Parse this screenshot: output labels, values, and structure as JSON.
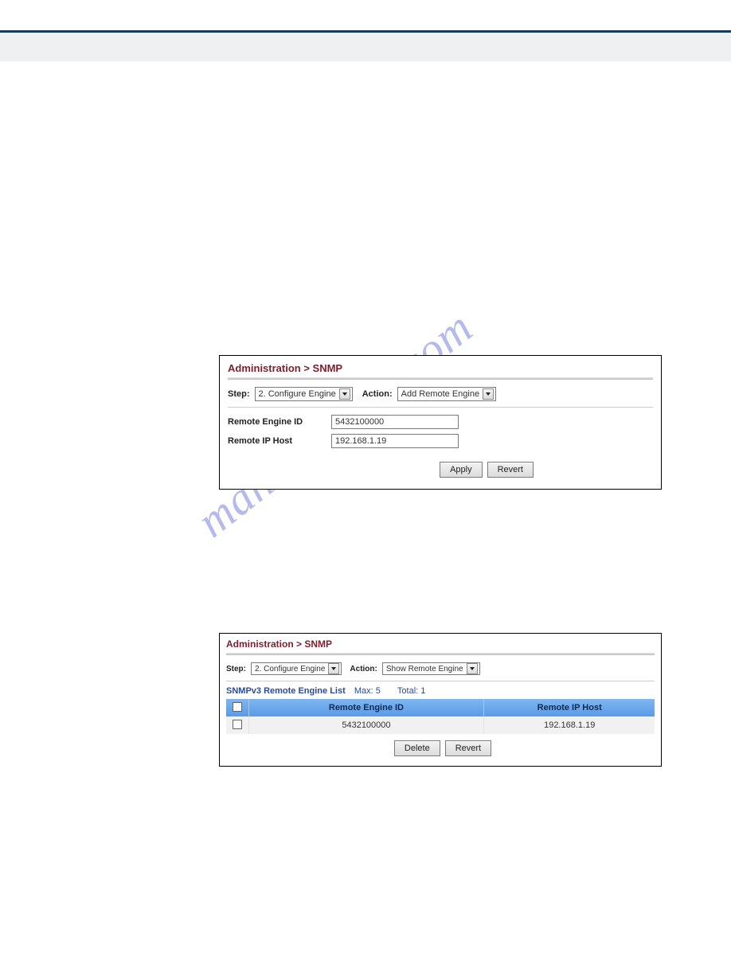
{
  "watermark": "manualshive.com",
  "panel1": {
    "breadcrumb": "Administration > SNMP",
    "stepLabel": "Step:",
    "stepValue": "2. Configure Engine",
    "actionLabel": "Action:",
    "actionValue": "Add Remote Engine",
    "fields": {
      "remoteEngineIdLabel": "Remote Engine ID",
      "remoteEngineIdValue": "5432100000",
      "remoteIpHostLabel": "Remote IP Host",
      "remoteIpHostValue": "192.168.1.19"
    },
    "buttons": {
      "apply": "Apply",
      "revert": "Revert"
    }
  },
  "panel2": {
    "breadcrumb": "Administration > SNMP",
    "stepLabel": "Step:",
    "stepValue": "2. Configure Engine",
    "actionLabel": "Action:",
    "actionValue": "Show Remote Engine",
    "listCaption": {
      "title": "SNMPv3 Remote Engine List",
      "max": "Max: 5",
      "total": "Total: 1"
    },
    "columns": {
      "engineId": "Remote Engine ID",
      "ipHost": "Remote IP Host"
    },
    "rows": [
      {
        "engineId": "5432100000",
        "ipHost": "192.168.1.19"
      }
    ],
    "buttons": {
      "delete": "Delete",
      "revert": "Revert"
    }
  }
}
